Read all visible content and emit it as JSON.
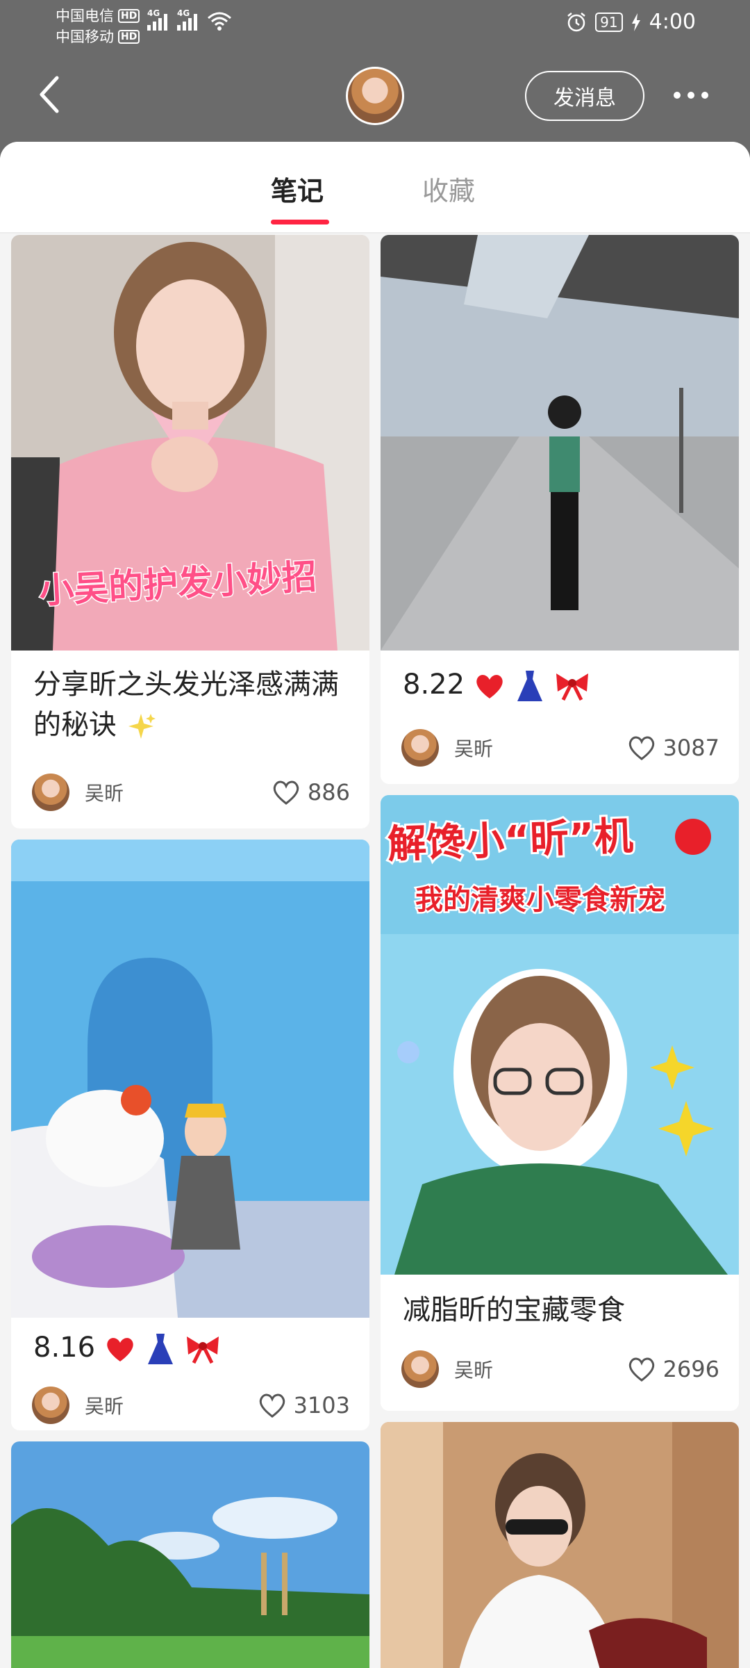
{
  "status_bar": {
    "carrier1": "中国电信",
    "carrier2": "中国移动",
    "hd": "HD",
    "net": "4G",
    "battery": "91",
    "time": "4:00"
  },
  "header": {
    "message_button": "发消息"
  },
  "tabs": {
    "notes": "笔记",
    "favorites": "收藏"
  },
  "cards": [
    {
      "title": "分享昕之头发光泽感满满的秘诀",
      "overlay": "小吴的护发小妙招",
      "author": "吴昕",
      "likes": "886"
    },
    {
      "title": "8.22",
      "author": "吴昕",
      "likes": "3087"
    },
    {
      "title": "8.16",
      "author": "吴昕",
      "likes": "3103"
    },
    {
      "title": "减脂昕的宝藏零食",
      "overlay_line1": "解馋小“昕”机",
      "overlay_line2": "我的清爽小零食新宠",
      "author": "吴昕",
      "likes": "2696"
    },
    {
      "title": ""
    },
    {
      "title": ""
    }
  ],
  "colors": {
    "accent": "#ff2442",
    "header_bg": "#6b6b6b"
  }
}
